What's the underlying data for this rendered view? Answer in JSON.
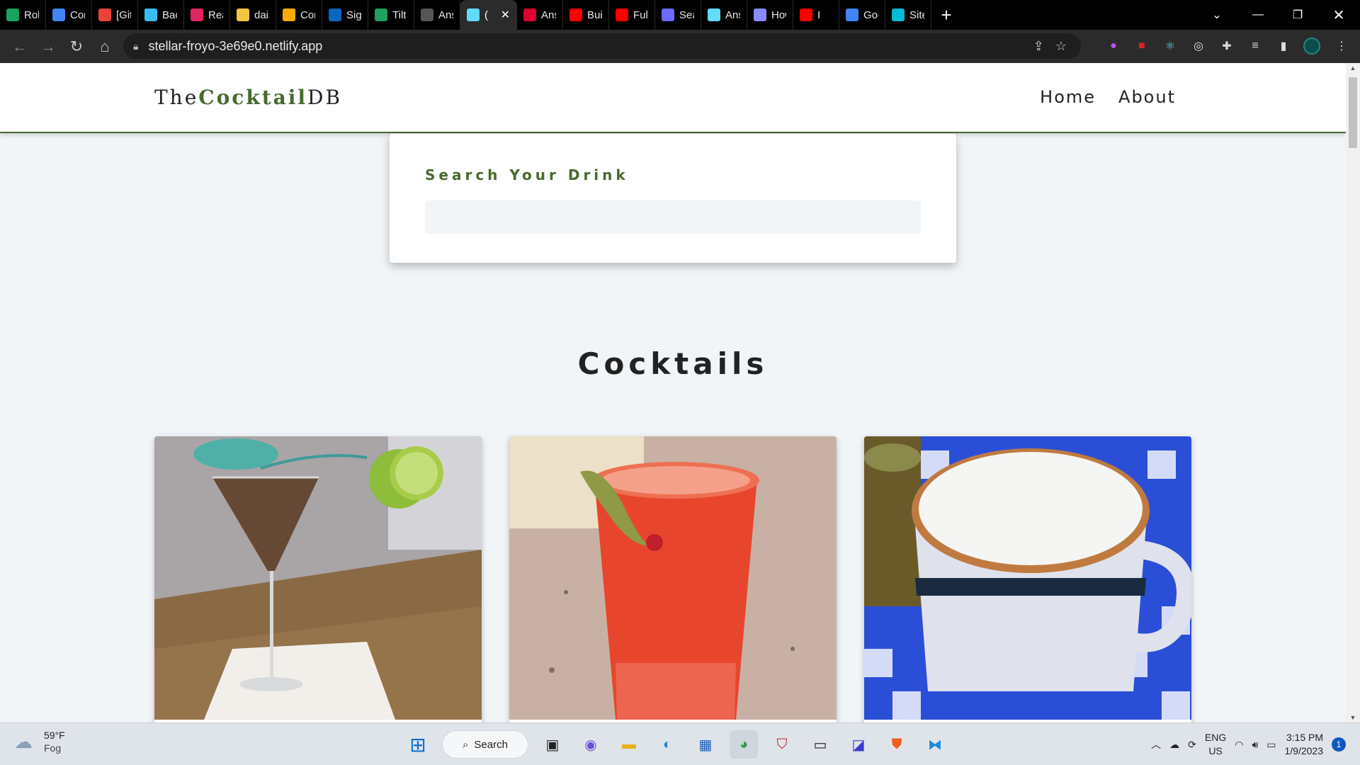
{
  "browser": {
    "tabs": [
      {
        "label": "Rohi",
        "icon": "chat-icon",
        "color": "#1aa260"
      },
      {
        "label": "Com",
        "icon": "docs-icon",
        "color": "#4285f4"
      },
      {
        "label": "[Gith",
        "icon": "gmail-icon",
        "color": "#ea4335"
      },
      {
        "label": "Back",
        "icon": "tailwind-icon",
        "color": "#38bdf8"
      },
      {
        "label": "Reac",
        "icon": "react-icon",
        "color": "#e0245e"
      },
      {
        "label": "dais",
        "icon": "flower-icon",
        "color": "#f4c542"
      },
      {
        "label": "Com",
        "icon": "notebook-icon",
        "color": "#f9ab00"
      },
      {
        "label": "Sign",
        "icon": "linkedin-icon",
        "color": "#0a66c2"
      },
      {
        "label": "Tilt",
        "icon": "tilt-icon",
        "color": "#20a060"
      },
      {
        "label": "Ansi",
        "icon": "github-icon",
        "color": "#555555"
      },
      {
        "label": "(",
        "icon": "react-icon",
        "color": "#61dafb",
        "active": true
      },
      {
        "label": "Ansi",
        "icon": "angular-icon",
        "color": "#dd0031"
      },
      {
        "label": "Builc",
        "icon": "youtube-icon",
        "color": "#ff0000"
      },
      {
        "label": "Full",
        "icon": "youtube-icon",
        "color": "#ff0000"
      },
      {
        "label": "Sear",
        "icon": "search-engine-icon",
        "color": "#6b6bff"
      },
      {
        "label": "Ansi",
        "icon": "react-icon",
        "color": "#61dafb"
      },
      {
        "label": "How",
        "icon": "lambda-icon",
        "color": "#8a8aff"
      },
      {
        "label": "I",
        "icon": "youtube-icon",
        "color": "#ff0000"
      },
      {
        "label": "Goo",
        "icon": "google-icon",
        "color": "#4285f4"
      },
      {
        "label": "Site",
        "icon": "diamond-icon",
        "color": "#00bcd4"
      }
    ],
    "url": "stellar-froyo-3e69e0.netlify.app"
  },
  "navbar": {
    "logo_prefix": "The",
    "logo_accent": "Cocktail",
    "logo_suffix": "DB",
    "links": [
      "Home",
      "About"
    ]
  },
  "search": {
    "label": "Search Your Drink",
    "value": ""
  },
  "section": {
    "title": "Cocktails"
  },
  "drinks": [
    {
      "photo": "martini-with-lime-and-umbrella"
    },
    {
      "photo": "red-drink-with-okra-garnish"
    },
    {
      "photo": "frothy-coffee-cup-on-checkered-cloth"
    }
  ],
  "taskbar": {
    "temperature": "59°F",
    "condition": "Fog",
    "search_label": "Search",
    "lang_top": "ENG",
    "lang_bottom": "US",
    "time": "3:15 PM",
    "date": "1/9/2023",
    "notifications": "1"
  },
  "colors": {
    "accent": "#476a2e",
    "page_bg": "#f1f5f8"
  }
}
